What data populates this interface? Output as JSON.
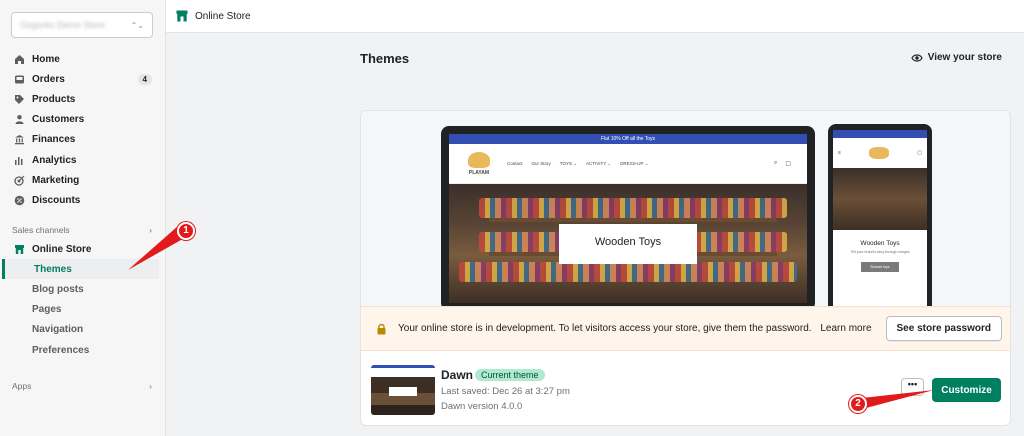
{
  "store": {
    "name": "Gogorko Demo Store"
  },
  "sidebar": {
    "items": [
      {
        "label": "Home",
        "icon": "home-icon"
      },
      {
        "label": "Orders",
        "icon": "orders-icon",
        "badge": "4"
      },
      {
        "label": "Products",
        "icon": "tag-icon"
      },
      {
        "label": "Customers",
        "icon": "person-icon"
      },
      {
        "label": "Finances",
        "icon": "bank-icon"
      },
      {
        "label": "Analytics",
        "icon": "bar-chart-icon"
      },
      {
        "label": "Marketing",
        "icon": "target-icon"
      },
      {
        "label": "Discounts",
        "icon": "discount-icon"
      }
    ],
    "sales_channels_label": "Sales channels",
    "online_store_label": "Online Store",
    "sub_items": [
      "Themes",
      "Blog posts",
      "Pages",
      "Navigation",
      "Preferences"
    ],
    "apps_label": "Apps"
  },
  "topbar": {
    "title": "Online Store"
  },
  "page": {
    "title": "Themes",
    "view_store": "View your store"
  },
  "preview": {
    "promo": "Flat 10% Off all the Toys",
    "logo": "PLAYAM",
    "nav": [
      "Contact",
      "Our Story",
      "TOYS ⌄",
      "ACTIVITY ⌄",
      "DRESS-UP ⌄"
    ],
    "hero_title": "Wooden Toys",
    "phone_sub": "Tell your brand's story through images",
    "phone_button": "Browse toys"
  },
  "banner": {
    "text": "Your online store is in development. To let visitors access your store, give them the password.",
    "learn_more": "Learn more",
    "button": "See store password"
  },
  "theme": {
    "name": "Dawn",
    "badge": "Current theme",
    "saved": "Last saved: Dec 26 at 3:27 pm",
    "version": "Dawn version 4.0.0",
    "more": "•••",
    "customize": "Customize"
  },
  "annotations": [
    "1",
    "2"
  ],
  "colors": {
    "accent": "#008060",
    "annotation": "#e11b1b",
    "promo": "#334fb4"
  }
}
